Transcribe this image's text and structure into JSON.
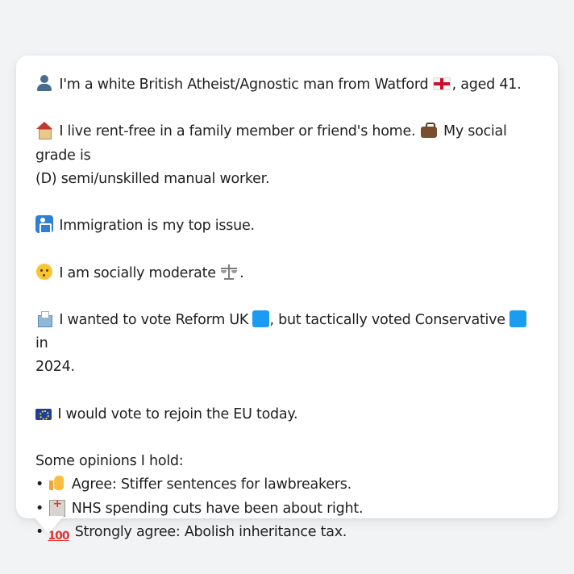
{
  "persona": {
    "intro_text": "I'm a white British Atheist/Agnostic man from Watford",
    "intro_suffix": ", aged 41.",
    "housing_text": "I live rent-free in a family member or friend's home.",
    "grade_text_line1": "My social grade is",
    "grade_text_line2": "(D) semi/unskilled manual worker.",
    "top_issue_text": "Immigration is my top issue.",
    "social_text": "I am socially moderate",
    "social_suffix": ".",
    "vote_text_a": "I wanted to vote Reform UK",
    "vote_text_b": ", but tactically voted Conservative",
    "vote_text_c": "in",
    "vote_text_line2": "2024.",
    "eu_text": "I would vote to rejoin the EU today.",
    "opinions_heading": "Some opinions I hold:",
    "bullet": "•",
    "opinions": [
      {
        "icon": "thumbs-up-icon",
        "text": "Agree: Stiffer sentences for lawbreakers."
      },
      {
        "icon": "hospital-icon",
        "text": "NHS spending cuts have been about right."
      },
      {
        "icon": "hundred-points-icon",
        "glyph": "100",
        "text": "Strongly agree: Abolish inheritance tax."
      }
    ]
  },
  "colors": {
    "reform_uk": "#1a9cf0",
    "conservative": "#1a9cf0",
    "background": "#f2f3f5",
    "card": "#ffffff",
    "text": "#1f1f1f"
  },
  "icons": {
    "intro": "person-icon",
    "hometown_flag": "flag-england-icon",
    "housing": "house-icon",
    "grade": "briefcase-icon",
    "issue": "passport-control-icon",
    "social": "thinking-face-icon",
    "social_scale": "scales-icon",
    "vote": "ballot-box-icon",
    "eu": "flag-eu-icon"
  }
}
